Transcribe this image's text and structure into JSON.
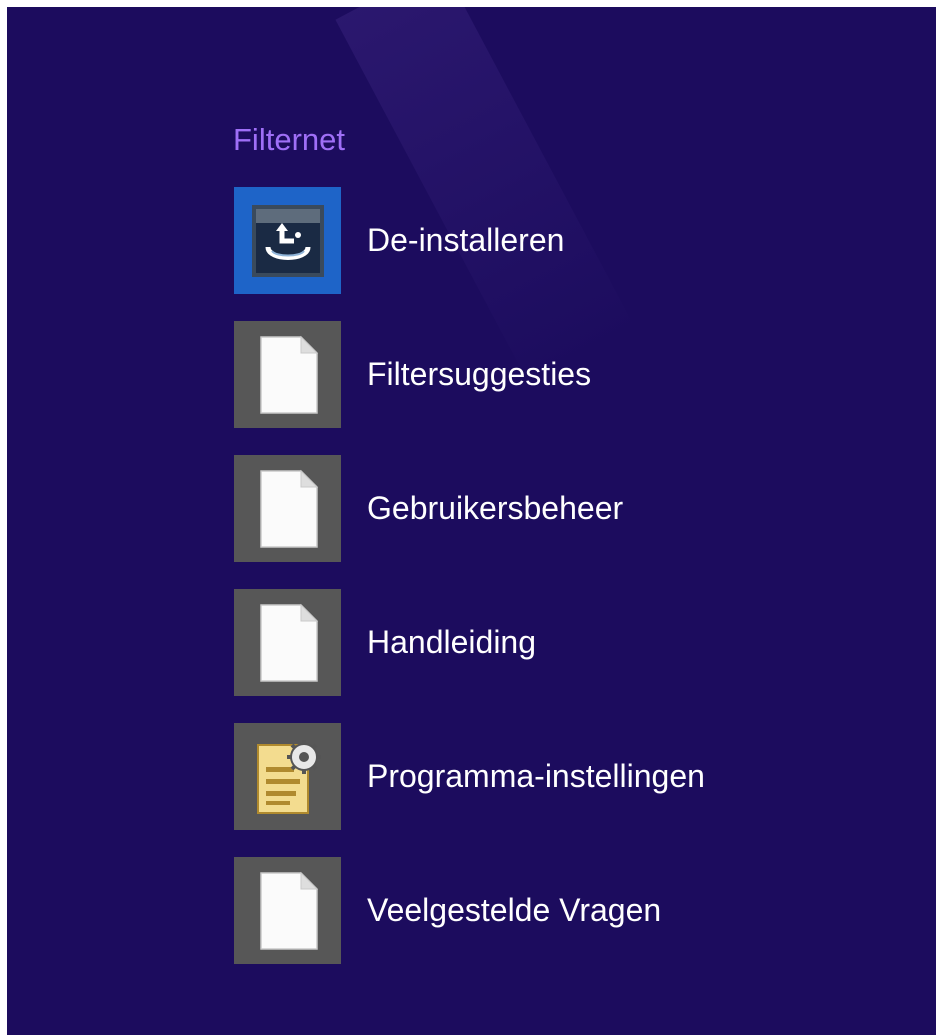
{
  "group": {
    "title": "Filternet"
  },
  "apps": [
    {
      "label": "De-installeren",
      "icon": "uninstall-icon",
      "tile_color": "#1e64c8"
    },
    {
      "label": "Filtersuggesties",
      "icon": "document-icon",
      "tile_color": "#575757"
    },
    {
      "label": "Gebruikersbeheer",
      "icon": "document-icon",
      "tile_color": "#575757"
    },
    {
      "label": "Handleiding",
      "icon": "document-icon",
      "tile_color": "#575757"
    },
    {
      "label": "Programma-instellingen",
      "icon": "settings-document-icon",
      "tile_color": "#575757"
    },
    {
      "label": "Veelgestelde Vragen",
      "icon": "document-icon",
      "tile_color": "#575757"
    }
  ],
  "colors": {
    "background": "#1c0c5e",
    "group_title": "#9f6ff7",
    "tile_default": "#575757",
    "tile_selected": "#1e64c8",
    "label": "#ffffff"
  }
}
